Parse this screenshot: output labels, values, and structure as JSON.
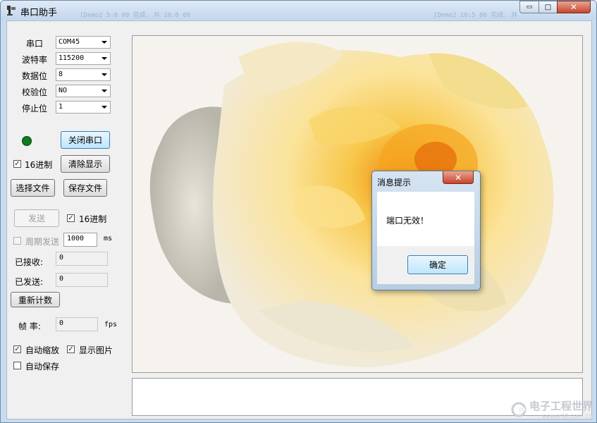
{
  "window": {
    "title": "串口助手",
    "ghost_left": "[Demo2 5:0 00 完成. 共 10:0 00",
    "ghost_right": "[Demo2 10:5 00 完成. 共",
    "buttons": {
      "minimize": "▭",
      "maximize": "□",
      "close": "✕"
    }
  },
  "settings": {
    "port_label": "串口",
    "port_value": "COM45",
    "baud_label": "波特率",
    "baud_value": "115200",
    "databits_label": "数据位",
    "databits_value": "8",
    "parity_label": "校验位",
    "parity_value": "NO",
    "stopbits_label": "停止位",
    "stopbits_value": "1"
  },
  "controls": {
    "close_port": "关闭串口",
    "hex_recv_label": "16进制",
    "hex_recv_checked": "✓",
    "clear_display": "清除显示",
    "choose_file": "选择文件",
    "save_file": "保存文件",
    "send": "发送",
    "hex_send_label": "16进制",
    "hex_send_checked": "✓",
    "periodic_label": "周期发送",
    "period_value": "1000",
    "period_unit": "ms",
    "received_label": "已接收:",
    "received_value": "0",
    "sent_label": "已发送:",
    "sent_value": "0",
    "reset_count": "重新计数",
    "fps_label": "帧  率:",
    "fps_value": "0",
    "fps_unit": "fps",
    "auto_zoom_label": "自动缩放",
    "auto_zoom_checked": "✓",
    "show_image_label": "显示图片",
    "show_image_checked": "✓",
    "auto_save_label": "自动保存"
  },
  "dialog": {
    "title": "消息提示",
    "message": "端口无效！",
    "ok": "确定",
    "close": "✕"
  },
  "watermark": {
    "cn": "电子工程世界",
    "en": "eeworld.com.cn"
  },
  "colors": {
    "led": "#0f7a20",
    "accent": "#3c7fb1"
  }
}
